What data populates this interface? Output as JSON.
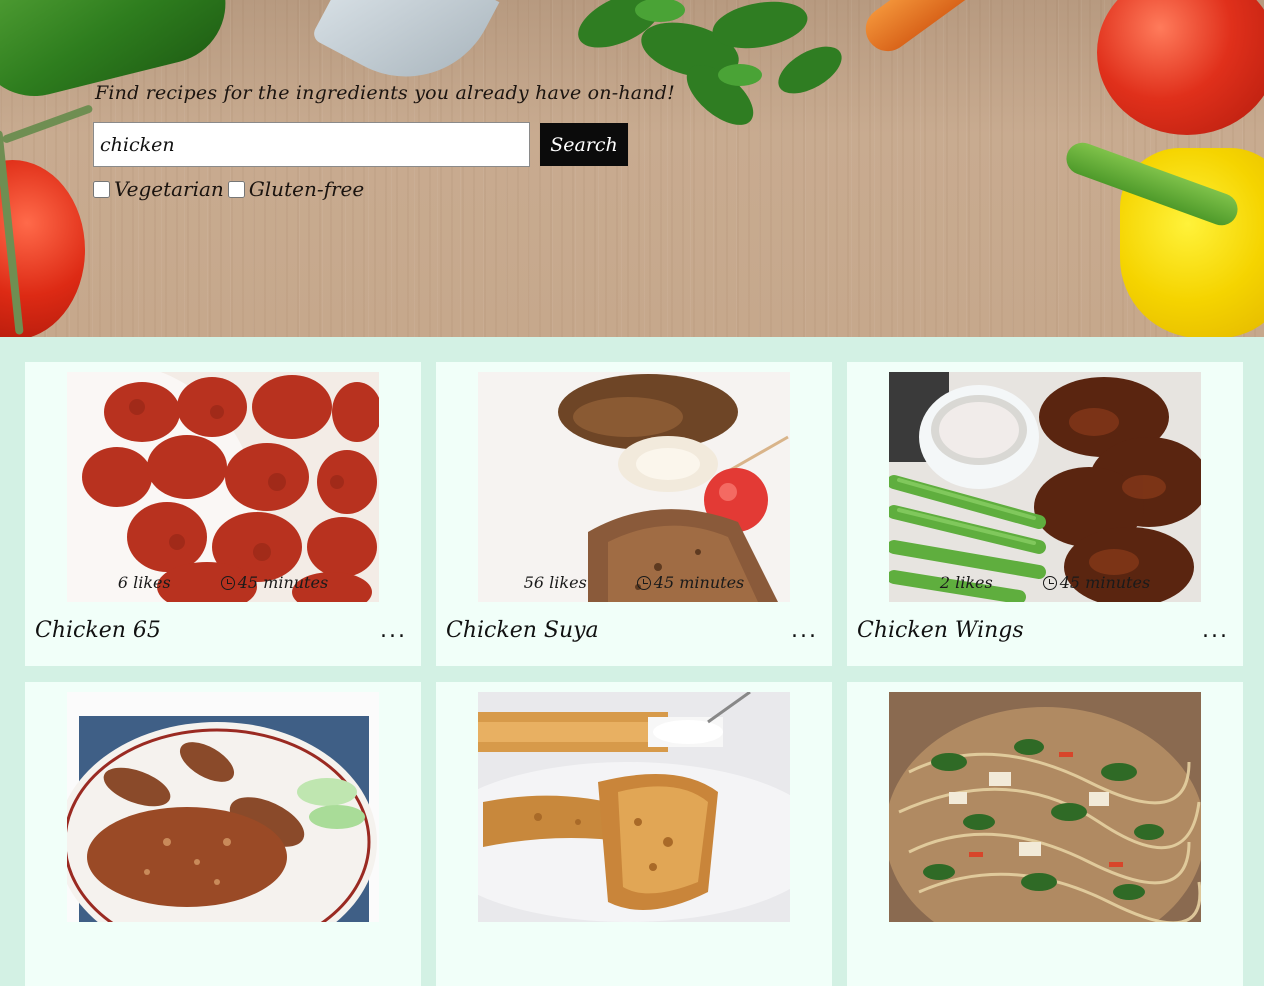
{
  "hero": {
    "tagline": "Find recipes for the ingredients you already have on-hand!",
    "search": {
      "value": "chicken",
      "button_label": "Search"
    },
    "filters": [
      {
        "label": "Vegetarian",
        "checked": false
      },
      {
        "label": "Gluten-free",
        "checked": false
      }
    ]
  },
  "recipes": [
    {
      "title": "Chicken 65",
      "likes": "6 likes",
      "time": "45 minutes",
      "more": "..."
    },
    {
      "title": "Chicken Suya",
      "likes": "56 likes",
      "time": "45 minutes",
      "more": "..."
    },
    {
      "title": "Chicken Wings",
      "likes": "2 likes",
      "time": "45 minutes",
      "more": "..."
    },
    {
      "title": "",
      "likes": "",
      "time": "",
      "more": ""
    },
    {
      "title": "",
      "likes": "",
      "time": "",
      "more": ""
    },
    {
      "title": "",
      "likes": "",
      "time": "",
      "more": ""
    }
  ],
  "colors": {
    "page_background": "#d3f1e4",
    "card_background": "#f1fff9",
    "button_background": "#0b0b0b"
  }
}
